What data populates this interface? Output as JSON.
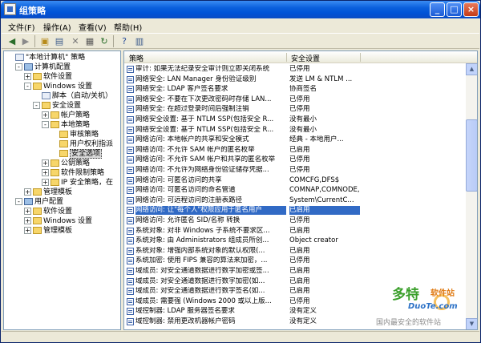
{
  "window": {
    "title": "组策略"
  },
  "menu": [
    "文件(F)",
    "操作(A)",
    "查看(V)",
    "帮助(H)"
  ],
  "toolbar_icons": [
    "back-arrow-icon",
    "forward-arrow-icon",
    "up-folder-icon",
    "show-tree-icon",
    "delete-icon",
    "properties-icon",
    "refresh-icon",
    "help-icon",
    "view-icon"
  ],
  "tree": [
    {
      "label": "\"本地计算机\" 策略",
      "level": 0,
      "icon": "doc",
      "expander": ""
    },
    {
      "label": "计算机配置",
      "level": 1,
      "icon": "computer",
      "expander": "-"
    },
    {
      "label": "软件设置",
      "level": 2,
      "icon": "folder",
      "expander": "+"
    },
    {
      "label": "Windows 设置",
      "level": 2,
      "icon": "folder",
      "expander": "-"
    },
    {
      "label": "脚本（启动/关机）",
      "level": 3,
      "icon": "doc",
      "expander": ""
    },
    {
      "label": "安全设置",
      "level": 3,
      "icon": "folder",
      "expander": "-"
    },
    {
      "label": "帐户策略",
      "level": 4,
      "icon": "folder",
      "expander": "+"
    },
    {
      "label": "本地策略",
      "level": 4,
      "icon": "folder",
      "expander": "-"
    },
    {
      "label": "审核策略",
      "level": 5,
      "icon": "folder",
      "expander": ""
    },
    {
      "label": "用户权利指派",
      "level": 5,
      "icon": "folder",
      "expander": ""
    },
    {
      "label": "安全选项",
      "level": 5,
      "icon": "folder",
      "expander": "",
      "selected": true
    },
    {
      "label": "公钥策略",
      "level": 4,
      "icon": "folder",
      "expander": "+"
    },
    {
      "label": "软件限制策略",
      "level": 4,
      "icon": "folder",
      "expander": "+"
    },
    {
      "label": "IP 安全策略，在",
      "level": 4,
      "icon": "folder",
      "expander": "+"
    },
    {
      "label": "管理模板",
      "level": 2,
      "icon": "folder",
      "expander": "+"
    },
    {
      "label": "用户配置",
      "level": 1,
      "icon": "computer",
      "expander": "-"
    },
    {
      "label": "软件设置",
      "level": 2,
      "icon": "folder",
      "expander": "+"
    },
    {
      "label": "Windows 设置",
      "level": 2,
      "icon": "folder",
      "expander": "+"
    },
    {
      "label": "管理模板",
      "level": 2,
      "icon": "folder",
      "expander": "+"
    }
  ],
  "list": {
    "columns": [
      "策略",
      "安全设置"
    ],
    "rows": [
      {
        "policy": "审计: 如果无法纪录安全审计则立即关闭系统",
        "setting": "已停用"
      },
      {
        "policy": "网络安全: LAN Manager 身份验证级别",
        "setting": "发送 LM & NTLM ..."
      },
      {
        "policy": "网络安全: LDAP 客户签名要求",
        "setting": "协商签名"
      },
      {
        "policy": "网络安全: 不要在下次更改密码时存储 LAN...",
        "setting": "已停用"
      },
      {
        "policy": "网络安全: 在超过登录时间后强制注销",
        "setting": "已停用"
      },
      {
        "policy": "网络安全设置: 基于 NTLM SSP(包括安全 R...",
        "setting": "没有最小"
      },
      {
        "policy": "网络安全设置: 基于 NTLM SSP(包括安全 R...",
        "setting": "没有最小"
      },
      {
        "policy": "网络访问: 本地帐户的共享和安全模式",
        "setting": "经典 - 本地用户..."
      },
      {
        "policy": "网络访问: 不允许 SAM 帐户的匿名枚举",
        "setting": "已启用"
      },
      {
        "policy": "网络访问: 不允许 SAM 帐户和共享的匿名枚举",
        "setting": "已停用"
      },
      {
        "policy": "网络访问: 不允许为网络身份验证储存凭据...",
        "setting": "已停用"
      },
      {
        "policy": "网络访问: 可匿名访问的共享",
        "setting": "COMCFG,DFS$"
      },
      {
        "policy": "网络访问: 可匿名访问的命名管道",
        "setting": "COMNAP,COMNODE,..."
      },
      {
        "policy": "网络访问: 可远程访问的注册表路径",
        "setting": "System\\CurrentC..."
      },
      {
        "policy": "网络访问: 让\"每个人\"权限应用于匿名用户",
        "setting": "已启用",
        "selected": true
      },
      {
        "policy": "网络访问: 允许匿名 SID/名称 转换",
        "setting": "已停用"
      },
      {
        "policy": "系统对象: 对非 Windows 子系统不要求区...",
        "setting": "已启用"
      },
      {
        "policy": "系统对象: 由 Administrators 组成员所创...",
        "setting": "Object creator"
      },
      {
        "policy": "系统对象: 增强内部系统对象的默认权限(...",
        "setting": "已启用"
      },
      {
        "policy": "系统加密: 使用 FIPS 兼容的算法来加密，...",
        "setting": "已停用"
      },
      {
        "policy": "域成员: 对安全通道数据进行数字加密或签...",
        "setting": "已启用"
      },
      {
        "policy": "域成员: 对安全通道数据进行数字加密(如...",
        "setting": "已启用"
      },
      {
        "policy": "域成员: 对安全通道数据进行数字签名(如...",
        "setting": "已启用"
      },
      {
        "policy": "域成员: 需要强 (Windows 2000 或以上版...",
        "setting": "已停用"
      },
      {
        "policy": "域控制器: LDAP 服务器签名要求",
        "setting": "没有定义"
      },
      {
        "policy": "域控制器: 禁用更改机器帐户密码",
        "setting": "没有定义"
      }
    ]
  },
  "watermark": {
    "logo": "多特",
    "logo_sub": "软件站",
    "url": "DuoTe.com",
    "slogan": "国内最安全的软件站"
  }
}
